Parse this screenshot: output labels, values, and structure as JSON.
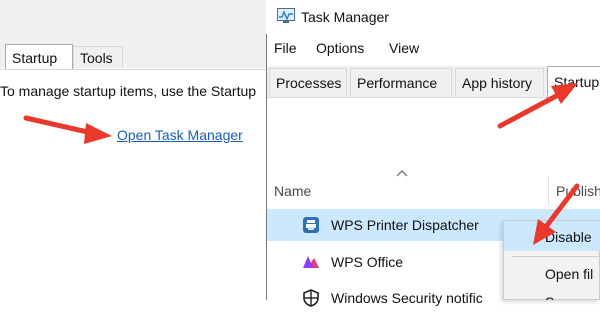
{
  "left_panel": {
    "tabs": [
      "Startup",
      "Tools"
    ],
    "description": "To manage startup items, use the Startup",
    "link": "Open Task Manager"
  },
  "task_manager": {
    "title": "Task Manager",
    "menu": [
      "File",
      "Options",
      "View"
    ],
    "tabs": [
      "Processes",
      "Performance",
      "App history",
      "Startup"
    ],
    "columns": {
      "name": "Name",
      "publisher": "Publish"
    },
    "rows": [
      {
        "label": "WPS Printer Dispatcher",
        "icon": "printer-icon"
      },
      {
        "label": "WPS Office",
        "icon": "wps-office-icon"
      },
      {
        "label": "Windows Security notific",
        "icon": "shield-icon"
      }
    ],
    "context_menu": [
      "Disable",
      "Open fil",
      "S"
    ]
  },
  "colors": {
    "annotation_arrow": "#e8392c",
    "selection": "#cce8ff",
    "link": "#1a5fb4"
  }
}
